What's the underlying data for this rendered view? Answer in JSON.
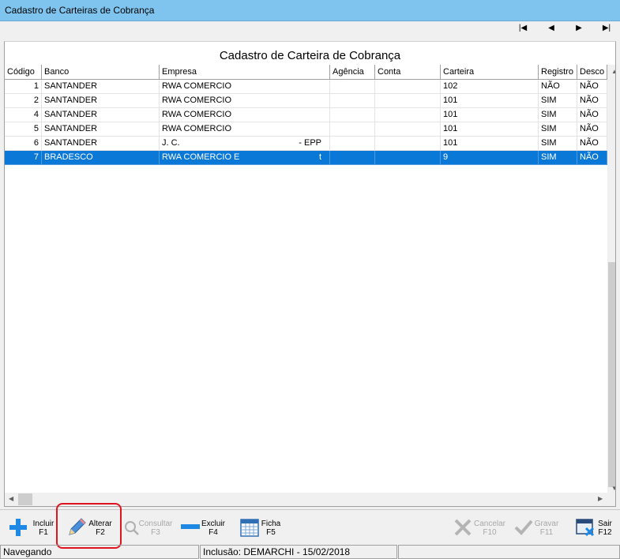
{
  "window": {
    "title": "Cadastro de Carteiras de Cobrança"
  },
  "nav": {
    "first": "|◀",
    "prev": "◀",
    "next": "▶",
    "last": "▶|"
  },
  "heading": "Cadastro de Carteira de Cobrança",
  "grid": {
    "columns": [
      "Código",
      "Banco",
      "Empresa",
      "Agência",
      "Conta",
      "Carteira",
      "Registro",
      "Desco"
    ],
    "rows": [
      {
        "codigo": "1",
        "banco": "SANTANDER",
        "empresa": "RWA COMERCIO",
        "empresa_tail": "",
        "agencia": "",
        "conta": "",
        "carteira": "102",
        "registro": "NÃO",
        "desco": "NÃO"
      },
      {
        "codigo": "2",
        "banco": "SANTANDER",
        "empresa": "RWA COMERCIO",
        "empresa_tail": "",
        "agencia": "",
        "conta": "",
        "carteira": "101",
        "registro": "SIM",
        "desco": "NÃO"
      },
      {
        "codigo": "4",
        "banco": "SANTANDER",
        "empresa": "RWA COMERCIO",
        "empresa_tail": "",
        "agencia": "",
        "conta": "",
        "carteira": "101",
        "registro": "SIM",
        "desco": "NÃO"
      },
      {
        "codigo": "5",
        "banco": "SANTANDER",
        "empresa": "RWA COMERCIO",
        "empresa_tail": "",
        "agencia": "",
        "conta": "",
        "carteira": "101",
        "registro": "SIM",
        "desco": "NÃO"
      },
      {
        "codigo": "6",
        "banco": "SANTANDER",
        "empresa": "J. C.",
        "empresa_tail": "- EPP",
        "agencia": "",
        "conta": "",
        "carteira": "101",
        "registro": "SIM",
        "desco": "NÃO"
      },
      {
        "codigo": "7",
        "banco": "BRADESCO",
        "empresa": "RWA COMERCIO E",
        "empresa_tail": "t",
        "agencia": "",
        "conta": "",
        "carteira": "9",
        "registro": "SIM",
        "desco": "NÃO"
      }
    ],
    "selected_index": 5
  },
  "toolbar": {
    "incluir": {
      "label": "Incluir",
      "key": "F1"
    },
    "alterar": {
      "label": "Alterar",
      "key": "F2"
    },
    "consultar": {
      "label": "Consultar",
      "key": "F3"
    },
    "excluir": {
      "label": "Excluir",
      "key": "F4"
    },
    "ficha": {
      "label": "Ficha",
      "key": "F5"
    },
    "cancelar": {
      "label": "Cancelar",
      "key": "F10"
    },
    "gravar": {
      "label": "Gravar",
      "key": "F11"
    },
    "sair": {
      "label": "Sair",
      "key": "F12"
    }
  },
  "status": {
    "mode": "Navegando",
    "info": "Inclusão: DEMARCHI - 15/02/2018"
  },
  "colors": {
    "titlebar": "#7ec4ee",
    "selection": "#0a78d7",
    "highlight_border": "#e0141e",
    "icon_blue": "#1e88e5"
  }
}
